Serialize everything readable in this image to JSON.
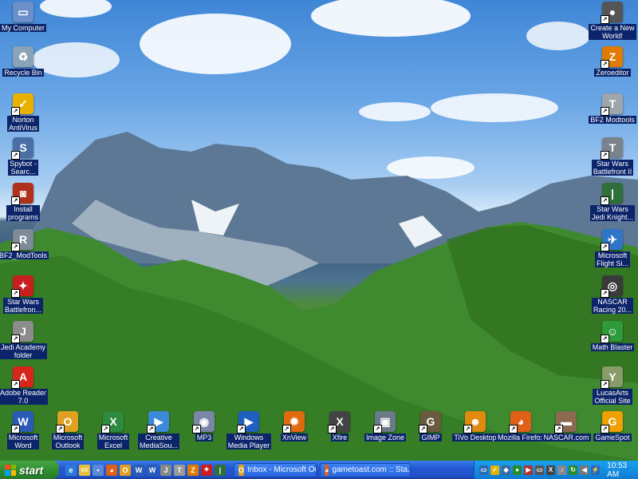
{
  "desktop": {
    "left_icons": [
      {
        "name": "my-computer",
        "label": "My Computer",
        "icon": "computer-icon",
        "glyph": "▭",
        "color": "#6b8fc9"
      },
      {
        "name": "recycle-bin",
        "label": "Recycle Bin",
        "icon": "recycle-bin-icon",
        "glyph": "♻",
        "color": "#8aa3b8"
      },
      {
        "name": "norton-antivirus",
        "label": "Norton\nAntiVirus",
        "icon": "norton-icon",
        "glyph": "✓",
        "color": "#e8b100"
      },
      {
        "name": "spybot",
        "label": "Spybot -\nSearc...",
        "icon": "spybot-icon",
        "glyph": "S",
        "color": "#4a6fa5"
      },
      {
        "name": "install-programs",
        "label": "Install\nprograms",
        "icon": "install-icon",
        "glyph": "◙",
        "color": "#b0301c"
      },
      {
        "name": "bf2-modtools-left",
        "label": "BF2_ModTools",
        "icon": "robot-icon",
        "glyph": "R",
        "color": "#7f8a99"
      },
      {
        "name": "star-wars-battlefront",
        "label": "Star Wars\nBattlefron...",
        "icon": "rebel-icon",
        "glyph": "✦",
        "color": "#c81e1e"
      },
      {
        "name": "jedi-academy",
        "label": "Jedi Academy\nfolder",
        "icon": "helmet-icon",
        "glyph": "J",
        "color": "#8c8c8c"
      },
      {
        "name": "adobe-reader",
        "label": "Adobe Reader\n7.0",
        "icon": "adobe-icon",
        "glyph": "A",
        "color": "#d9261c"
      }
    ],
    "right_icons": [
      {
        "name": "create-new-world",
        "label": "Create a New\nWorld!",
        "icon": "deathstar-icon",
        "glyph": "●",
        "color": "#555"
      },
      {
        "name": "zeroeditor",
        "label": "Zeroeditor",
        "icon": "zeroeditor-icon",
        "glyph": "Z",
        "color": "#e07a00"
      },
      {
        "name": "bf2-modtools-right",
        "label": "BF2 Modtools",
        "icon": "trooper-icon",
        "glyph": "T",
        "color": "#9da5ad"
      },
      {
        "name": "star-wars-battlefront-2",
        "label": "Star Wars\nBattlefront II",
        "icon": "trooper-icon",
        "glyph": "T",
        "color": "#7a838c"
      },
      {
        "name": "jedi-knight",
        "label": "Star Wars\nJedi Knight...",
        "icon": "lightsaber-icon",
        "glyph": "|",
        "color": "#2f6f3a"
      },
      {
        "name": "flight-simulator",
        "label": "Microsoft\nFlight Si...",
        "icon": "plane-icon",
        "glyph": "✈",
        "color": "#2f75c8"
      },
      {
        "name": "nascar-racing",
        "label": "NASCAR\nRacing 20...",
        "icon": "tire-icon",
        "glyph": "◎",
        "color": "#3a3a3a"
      },
      {
        "name": "math-blaster",
        "label": "Math Blaster",
        "icon": "alien-icon",
        "glyph": "☺",
        "color": "#2f9a3a"
      },
      {
        "name": "lucasarts",
        "label": "LucasArts\nOfficial Site",
        "icon": "yoda-icon",
        "glyph": "Y",
        "color": "#8a9a6a"
      }
    ],
    "bottom_icons": [
      {
        "name": "microsoft-word",
        "label": "Microsoft\nWord",
        "icon": "word-icon",
        "glyph": "W",
        "color": "#2a5bb8"
      },
      {
        "name": "microsoft-outlook",
        "label": "Microsoft\nOutlook",
        "icon": "outlook-icon",
        "glyph": "O",
        "color": "#e0a020"
      },
      {
        "name": "microsoft-excel",
        "label": "Microsoft\nExcel",
        "icon": "excel-icon",
        "glyph": "X",
        "color": "#2d8a3e"
      },
      {
        "name": "creative-mediasource",
        "label": "Creative\nMediaSou...",
        "icon": "media-play-icon",
        "glyph": "▶",
        "color": "#3a8ad8"
      },
      {
        "name": "mp3",
        "label": "MP3",
        "icon": "cd-icon",
        "glyph": "◉",
        "color": "#7a86a8"
      },
      {
        "name": "windows-media-player",
        "label": "Windows\nMedia Player",
        "icon": "media-player-icon",
        "glyph": "▶",
        "color": "#1f5fc0"
      },
      {
        "name": "xnview",
        "label": "XnView",
        "icon": "xnview-icon",
        "glyph": "✹",
        "color": "#e06a10"
      },
      {
        "name": "xfire",
        "label": "Xfire",
        "icon": "xfire-icon",
        "glyph": "X",
        "color": "#444"
      },
      {
        "name": "image-zone",
        "label": "Image Zone",
        "icon": "image-zone-icon",
        "glyph": "▣",
        "color": "#6a7a8a"
      },
      {
        "name": "gimp",
        "label": "GIMP",
        "icon": "gimp-icon",
        "glyph": "G",
        "color": "#6a5a40"
      },
      {
        "name": "tivo-desktop",
        "label": "TiVo Desktop",
        "icon": "tivo-icon",
        "glyph": "☻",
        "color": "#e08a10"
      },
      {
        "name": "mozilla-firefox",
        "label": "Mozilla Firefox",
        "icon": "firefox-icon",
        "glyph": "◕",
        "color": "#e0601a"
      },
      {
        "name": "nascar-com",
        "label": "NASCAR.com",
        "icon": "nascar-car-icon",
        "glyph": "▬",
        "color": "#8a6a50"
      },
      {
        "name": "gamespot",
        "label": "GameSpot",
        "icon": "gamespot-icon",
        "glyph": "G",
        "color": "#f0a000"
      }
    ]
  },
  "taskbar": {
    "start_label": "start",
    "quick_launch": [
      {
        "name": "ie",
        "icon": "ie-icon",
        "glyph": "e",
        "color": "#2f7ad8"
      },
      {
        "name": "folder",
        "icon": "folder-icon",
        "glyph": "▭",
        "color": "#e8c040"
      },
      {
        "name": "desktop",
        "icon": "show-desktop-icon",
        "glyph": "▪",
        "color": "#5a8ad8"
      },
      {
        "name": "firefox",
        "icon": "firefox-icon",
        "glyph": "◕",
        "color": "#e0601a"
      },
      {
        "name": "outlook",
        "icon": "outlook-icon",
        "glyph": "O",
        "color": "#e0a020"
      },
      {
        "name": "word",
        "icon": "word-icon",
        "glyph": "W",
        "color": "#2a5bb8"
      },
      {
        "name": "word2",
        "icon": "word-icon",
        "glyph": "W",
        "color": "#2a5bb8"
      },
      {
        "name": "helmet",
        "icon": "helmet-icon",
        "glyph": "J",
        "color": "#888"
      },
      {
        "name": "trooper",
        "icon": "trooper-icon",
        "glyph": "T",
        "color": "#999"
      },
      {
        "name": "zero",
        "icon": "zeroeditor-icon",
        "glyph": "Z",
        "color": "#e07a00"
      },
      {
        "name": "rebel",
        "icon": "rebel-icon",
        "glyph": "✦",
        "color": "#c81e1e"
      },
      {
        "name": "saber",
        "icon": "lightsaber-icon",
        "glyph": "|",
        "color": "#2f6f3a"
      }
    ],
    "tasks": [
      {
        "name": "task-outlook",
        "label": "Inbox - Microsoft Out...",
        "icon": "outlook-icon",
        "glyph": "O",
        "color": "#e0a020",
        "width": 104
      },
      {
        "name": "task-firefox",
        "label": "gametoast.com :: Sta...",
        "icon": "firefox-icon",
        "glyph": "◕",
        "color": "#e0601a",
        "width": 114
      }
    ],
    "tray_icons": [
      {
        "name": "tray-1",
        "icon": "network-icon",
        "glyph": "▭",
        "color": "#2a6ab8"
      },
      {
        "name": "tray-2",
        "icon": "norton-icon",
        "glyph": "✓",
        "color": "#e8b100"
      },
      {
        "name": "tray-3",
        "icon": "shield-icon",
        "glyph": "◆",
        "color": "#3a6a9a"
      },
      {
        "name": "tray-4",
        "icon": "chat-icon",
        "glyph": "●",
        "color": "#2a8a2a"
      },
      {
        "name": "tray-5",
        "icon": "media-icon",
        "glyph": "▶",
        "color": "#b03030"
      },
      {
        "name": "tray-6",
        "icon": "monitor-icon",
        "glyph": "▭",
        "color": "#555"
      },
      {
        "name": "tray-7",
        "icon": "xfire-icon",
        "glyph": "X",
        "color": "#444"
      },
      {
        "name": "tray-8",
        "icon": "audio-icon",
        "glyph": "♪",
        "color": "#888"
      },
      {
        "name": "tray-9",
        "icon": "update-icon",
        "glyph": "↻",
        "color": "#2a8a2a"
      },
      {
        "name": "tray-10",
        "icon": "volume-icon",
        "glyph": "◀",
        "color": "#777"
      },
      {
        "name": "tray-11",
        "icon": "usb-icon",
        "glyph": "⚡",
        "color": "#2a6ab8"
      }
    ],
    "clock": "10:53 AM"
  }
}
